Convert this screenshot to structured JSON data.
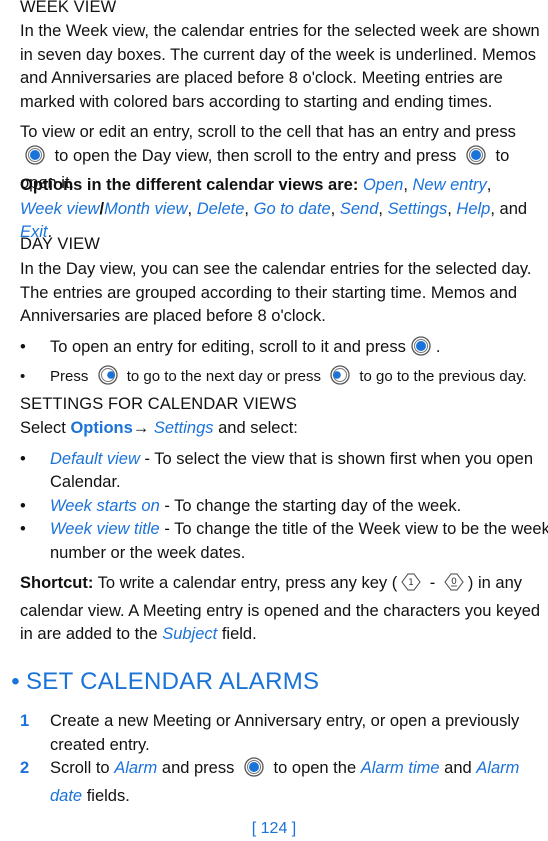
{
  "week_view": {
    "heading": "WEEK VIEW",
    "para1": "In the Week view, the calendar entries for the selected week are shown in seven day boxes. The current day of the week is underlined. Memos and Anniversaries are placed before 8 o'clock. Meeting entries are marked with colored bars according to starting and ending times.",
    "para2_a": "To view or edit an entry, scroll to the cell that has an entry and press",
    "para2_b": "to open the Day view, then scroll to the entry and press",
    "para2_c": "to open it.",
    "options_label": "Options in the different calendar views are:",
    "options": [
      "Open",
      "New entry",
      "Week view",
      "Month view",
      "Delete",
      "Go to date",
      "Send",
      "Settings",
      "Help",
      "Exit"
    ],
    "sep_comma": ",",
    "sep_slash": "/",
    "and_word": "and",
    "period": "."
  },
  "day_view": {
    "heading": "DAY VIEW",
    "para": "In the Day view, you can see the calendar entries for the selected day. The entries are grouped according to their starting time. Memos and Anniversaries are placed before 8 o'clock.",
    "bullet1_a": "To open an entry for editing, scroll to it and press",
    "bullet1_b": ".",
    "bullet2_a": "Press",
    "bullet2_b": "to go to the next day or press",
    "bullet2_c": "to go to the previous day."
  },
  "settings": {
    "heading": "SETTINGS FOR CALENDAR VIEWS",
    "select_word": "Select",
    "options_word": "Options",
    "arrow": "→",
    "settings_word": "Settings",
    "and_select": "and select:",
    "items": [
      {
        "term": "Default view",
        "desc": " - To select the view that is shown first when you open Calendar."
      },
      {
        "term": "Week starts on",
        "desc": " - To change the starting day of the week."
      },
      {
        "term": "Week view title",
        "desc": "  - To change the title of the Week view to be the week number or the week dates."
      }
    ]
  },
  "shortcut": {
    "label": "Shortcut:",
    "text_a": "To write a calendar entry, press any key (",
    "dash": "-",
    "text_b": ") in any calendar view. A Meeting entry is opened and the characters you keyed in are added to the",
    "subject": "Subject",
    "text_c": "field.",
    "key_first": "1",
    "key_last": "0"
  },
  "alarms": {
    "heading": "SET CALENDAR ALARMS",
    "bullet": "•",
    "steps": [
      {
        "num": "1",
        "text": "Create a new Meeting or Anniversary entry, or open a previously created entry."
      },
      {
        "num": "2",
        "a": "Scroll to",
        "alarm": "Alarm",
        "b": "and press",
        "c": "to open the",
        "alarm_time": "Alarm time",
        "and_word": "and",
        "alarm_date": "Alarm date",
        "d": "fields."
      }
    ]
  },
  "footer": {
    "page_number": "[ 124 ]"
  },
  "colors": {
    "accent": "#1a73d9",
    "text": "#111111",
    "icon_ring": "#555555"
  },
  "icons": {
    "joystick": "joystick-press-icon",
    "joystick_right": "joystick-right-icon",
    "joystick_left": "joystick-left-icon",
    "key": "keypad-key-icon"
  },
  "list_bullet": "•"
}
